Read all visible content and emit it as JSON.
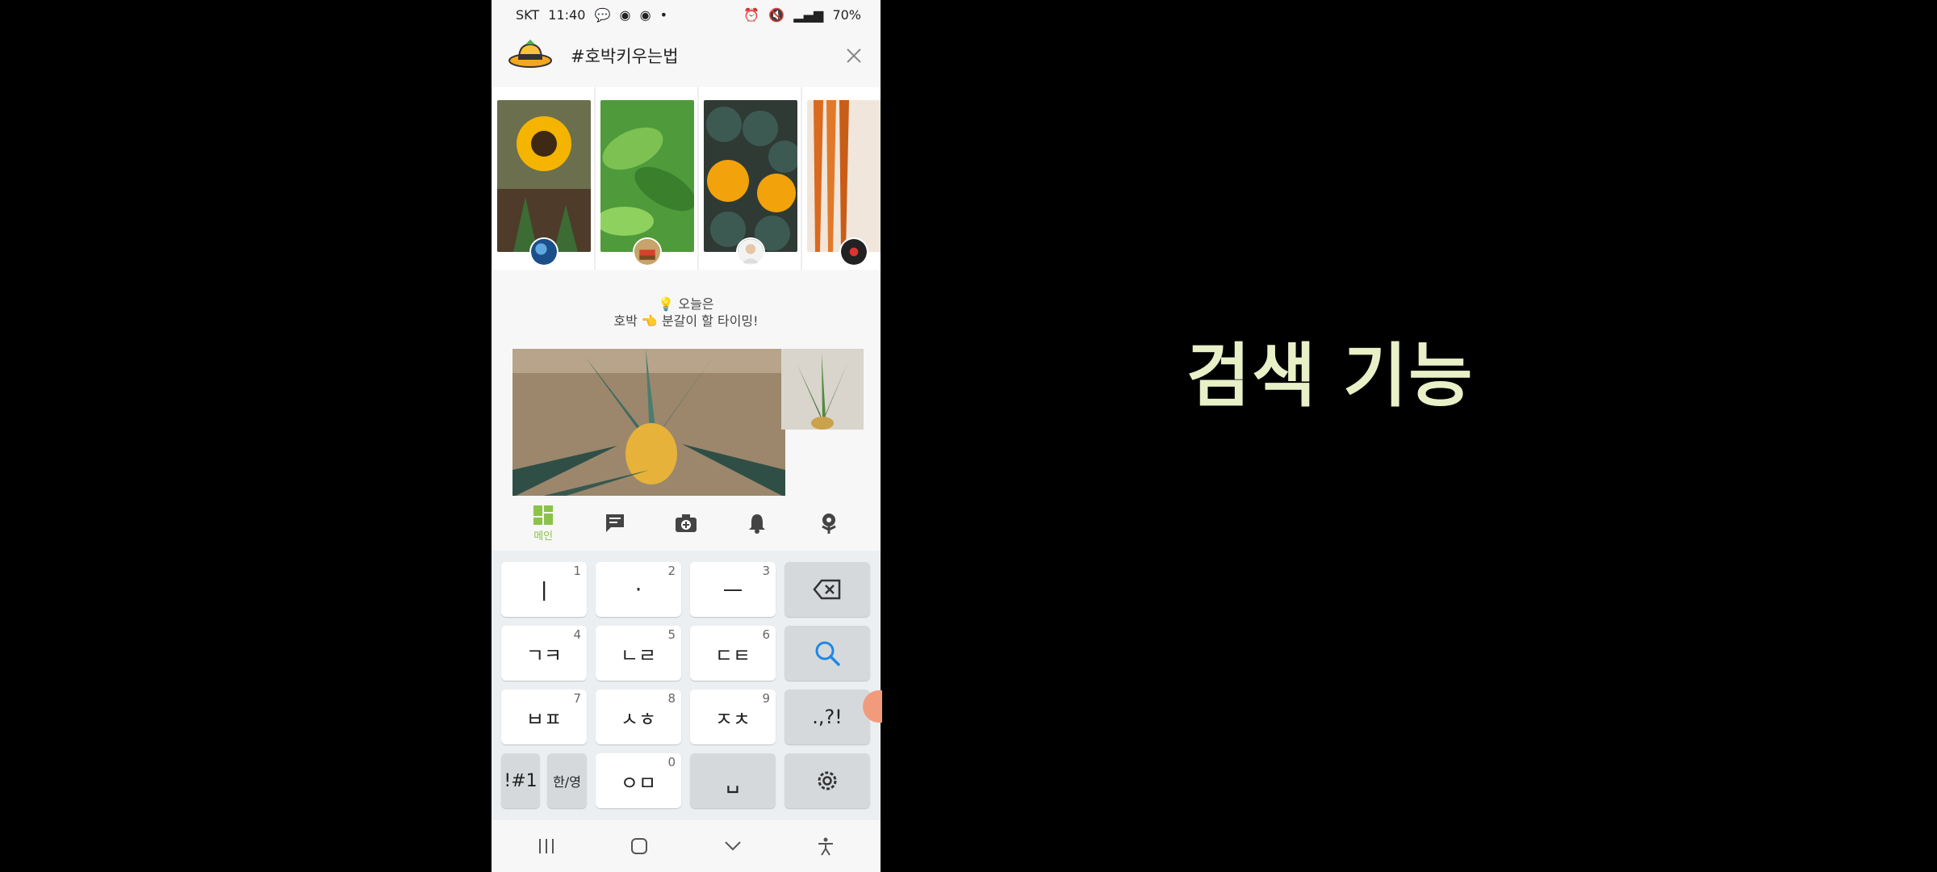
{
  "status_bar": {
    "carrier": "SKT",
    "time": "11:40",
    "battery": "70%"
  },
  "search": {
    "query": "#호박키우는법"
  },
  "stories": [
    {
      "subject": "sunflower"
    },
    {
      "subject": "leafy plant"
    },
    {
      "subject": "pumpkins"
    },
    {
      "subject": "carrots"
    }
  ],
  "tip": {
    "line1": "💡 오늘은",
    "line2": "호박 👈 분갈이 할 타이밍!"
  },
  "bottom_nav": {
    "items": [
      {
        "label": "메인",
        "icon": "grid-icon",
        "active": true
      },
      {
        "label": "",
        "icon": "chat-icon"
      },
      {
        "label": "",
        "icon": "camera-icon"
      },
      {
        "label": "",
        "icon": "bell-icon"
      },
      {
        "label": "",
        "icon": "flower-icon"
      }
    ],
    "accent": "#8bc34a"
  },
  "keyboard": {
    "rows": [
      [
        {
          "label": "ㅣ",
          "num": "1"
        },
        {
          "label": "·",
          "num": "2"
        },
        {
          "label": "ㅡ",
          "num": "3"
        },
        {
          "label": "",
          "icon": "backspace-icon"
        }
      ],
      [
        {
          "label": "ㄱㅋ",
          "num": "4"
        },
        {
          "label": "ㄴㄹ",
          "num": "5"
        },
        {
          "label": "ㄷㅌ",
          "num": "6"
        },
        {
          "label": "",
          "icon": "search-icon"
        }
      ],
      [
        {
          "label": "ㅂㅍ",
          "num": "7"
        },
        {
          "label": "ㅅㅎ",
          "num": "8"
        },
        {
          "label": "ㅈㅊ",
          "num": "9"
        },
        {
          "label": ".,?!"
        }
      ],
      [
        {
          "label": "!#1"
        },
        {
          "label": "한/영"
        },
        {
          "label": "ㅇㅁ",
          "num": "0"
        },
        {
          "label": "␣"
        },
        {
          "label": "",
          "icon": "gear-icon"
        }
      ]
    ],
    "search_color": "#1e88e5"
  },
  "overlay_title": "검색 기능"
}
